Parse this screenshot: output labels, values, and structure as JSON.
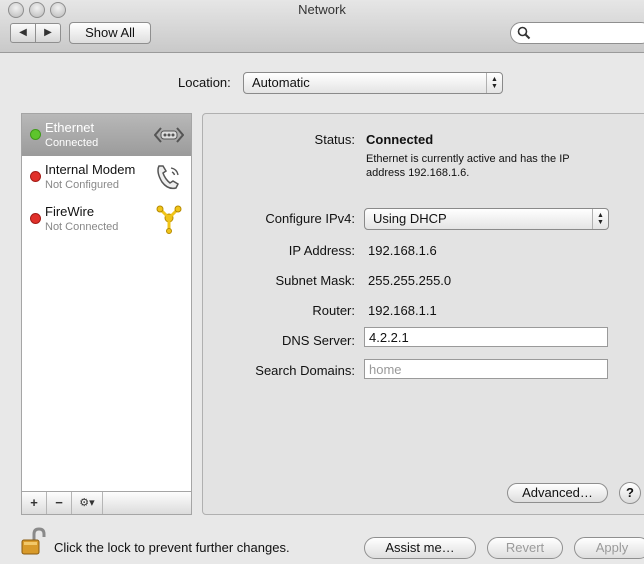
{
  "window": {
    "title": "Network"
  },
  "toolbar": {
    "show_all_label": "Show All",
    "back_icon": "◀",
    "forward_icon": "▶",
    "search_placeholder": ""
  },
  "location": {
    "label": "Location:",
    "value": "Automatic"
  },
  "services": [
    {
      "name": "Ethernet",
      "status": "Connected",
      "status_color": "#5ec52d",
      "icon": "ethernet-icon",
      "selected": true
    },
    {
      "name": "Internal Modem",
      "status": "Not Configured",
      "status_color": "#e0302a",
      "icon": "phone-icon",
      "selected": false
    },
    {
      "name": "FireWire",
      "status": "Not Connected",
      "status_color": "#e0302a",
      "icon": "firewire-icon",
      "selected": false
    }
  ],
  "sidebar_actions": {
    "add": "+",
    "remove": "−",
    "gear": "⚙▾"
  },
  "detail": {
    "status_label": "Status:",
    "status_value": "Connected",
    "status_desc_line1": "Ethernet is currently active and has the IP",
    "status_desc_line2": "address 192.168.1.6.",
    "configure_label": "Configure IPv4:",
    "configure_value": "Using DHCP",
    "ip_label": "IP Address:",
    "ip_value": "192.168.1.6",
    "subnet_label": "Subnet Mask:",
    "subnet_value": "255.255.255.0",
    "router_label": "Router:",
    "router_value": "192.168.1.1",
    "dns_label": "DNS Server:",
    "dns_value": "4.2.2.1",
    "search_domains_label": "Search Domains:",
    "search_domains_placeholder": "home"
  },
  "buttons": {
    "advanced": "Advanced…",
    "help": "?",
    "assist": "Assist me…",
    "revert": "Revert",
    "apply": "Apply"
  },
  "lock": {
    "text": "Click the lock to prevent further changes."
  }
}
